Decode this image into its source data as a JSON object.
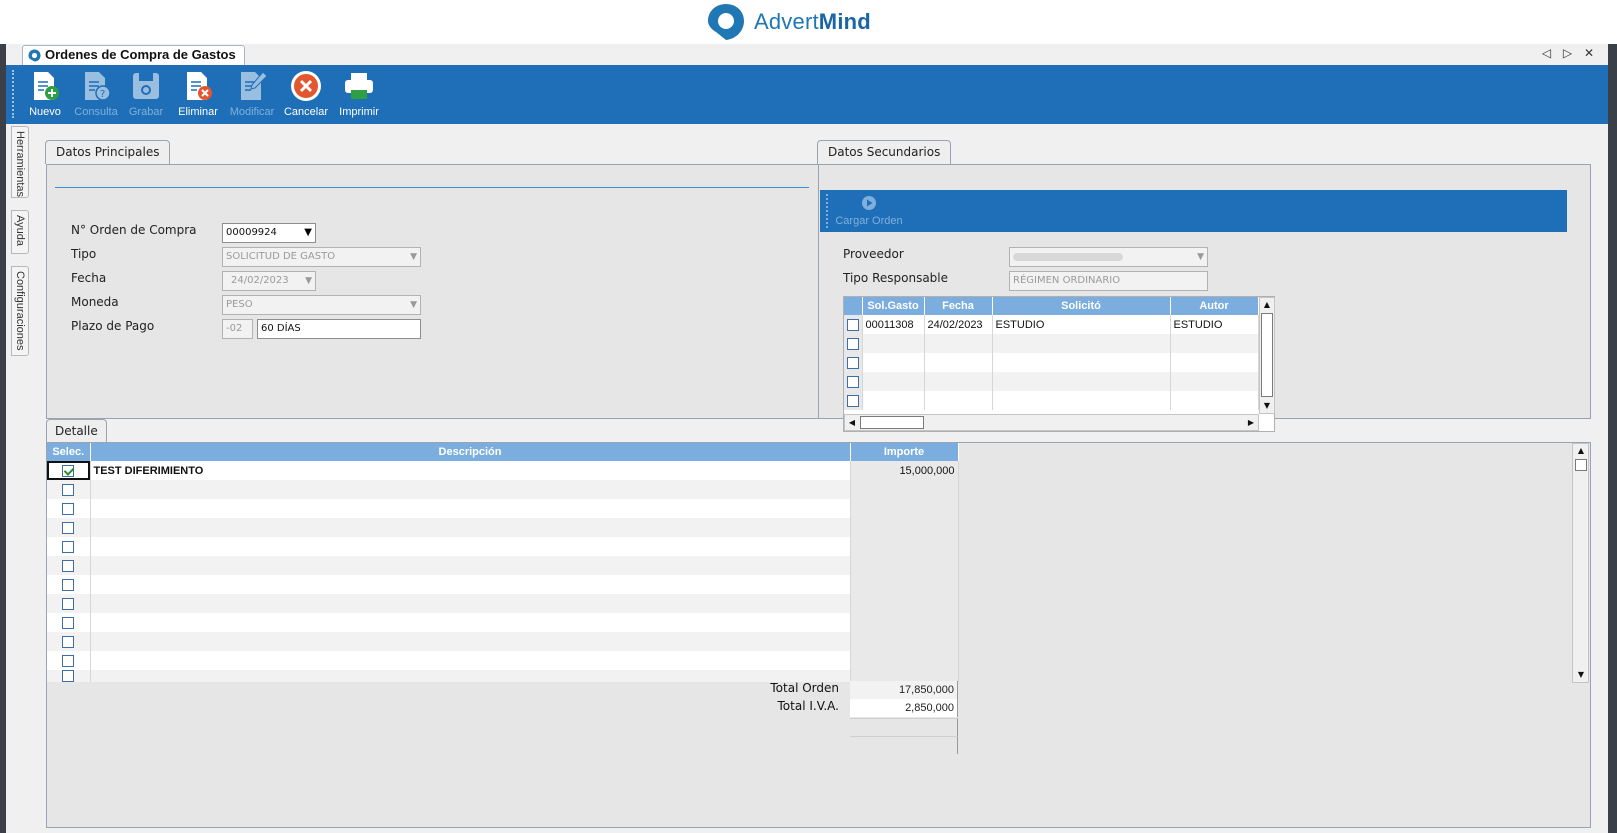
{
  "brand": {
    "name_light": "Advert",
    "name_bold": "Mind",
    "color": "#1f77b4"
  },
  "window": {
    "tab_title": "Ordenes de Compra de Gastos",
    "tab_nav": "◁ ▷ ✕"
  },
  "toolbar": {
    "bg": "#1e6fb8",
    "buttons": {
      "nuevo": "Nuevo",
      "consulta": "Consulta",
      "grabar": "Grabar",
      "eliminar": "Eliminar",
      "modificar": "Modificar",
      "cancelar": "Cancelar",
      "imprimir": "Imprimir"
    }
  },
  "side_tabs": {
    "herramientas": "Herramientas",
    "ayuda": "Ayuda",
    "configuraciones": "Configuraciones"
  },
  "principal": {
    "tab": "Datos Principales",
    "labels": {
      "orden": "N° Orden de Compra",
      "tipo": "Tipo",
      "fecha": "Fecha",
      "moneda": "Moneda",
      "plazo": "Plazo de Pago"
    },
    "values": {
      "orden": "00009924",
      "tipo": "SOLICITUD DE GASTO",
      "fecha": "24/02/2023",
      "moneda": "PESO",
      "plazo_code": "-02",
      "plazo_desc": "60 DÍAS"
    }
  },
  "secundarios": {
    "tab": "Datos Secundarios",
    "cargar_orden": "Cargar Orden",
    "labels": {
      "proveedor": "Proveedor",
      "tipo_responsable": "Tipo Responsable"
    },
    "values": {
      "proveedor": "",
      "tipo_responsable": "RÉGIMEN ORDINARIO"
    },
    "grid": {
      "headers": [
        "Sol.Gasto",
        "Fecha",
        "Solicitó",
        "Autor"
      ],
      "rows": [
        [
          "00011308",
          "24/02/2023",
          "ESTUDIO",
          "ESTUDIO"
        ],
        [
          "",
          "",
          "",
          ""
        ],
        [
          "",
          "",
          "",
          ""
        ],
        [
          "",
          "",
          "",
          ""
        ],
        [
          "",
          "",
          "",
          ""
        ]
      ]
    }
  },
  "detalle": {
    "tab": "Detalle",
    "headers": {
      "sel": "Selec.",
      "desc": "Descripción",
      "importe": "Importe"
    },
    "rows": [
      {
        "checked": true,
        "desc": "TEST DIFERIMIENTO",
        "importe": "15,000,000"
      },
      {
        "checked": false,
        "desc": "",
        "importe": ""
      },
      {
        "checked": false,
        "desc": "",
        "importe": ""
      },
      {
        "checked": false,
        "desc": "",
        "importe": ""
      },
      {
        "checked": false,
        "desc": "",
        "importe": ""
      },
      {
        "checked": false,
        "desc": "",
        "importe": ""
      },
      {
        "checked": false,
        "desc": "",
        "importe": ""
      },
      {
        "checked": false,
        "desc": "",
        "importe": ""
      },
      {
        "checked": false,
        "desc": "",
        "importe": ""
      },
      {
        "checked": false,
        "desc": "",
        "importe": ""
      },
      {
        "checked": false,
        "desc": "",
        "importe": ""
      },
      {
        "checked": false,
        "desc": "",
        "importe": ""
      }
    ],
    "totals": {
      "orden_label": "Total Orden",
      "orden_value": "17,850,000",
      "iva_label": "Total I.V.A.",
      "iva_value": "2,850,000"
    }
  }
}
